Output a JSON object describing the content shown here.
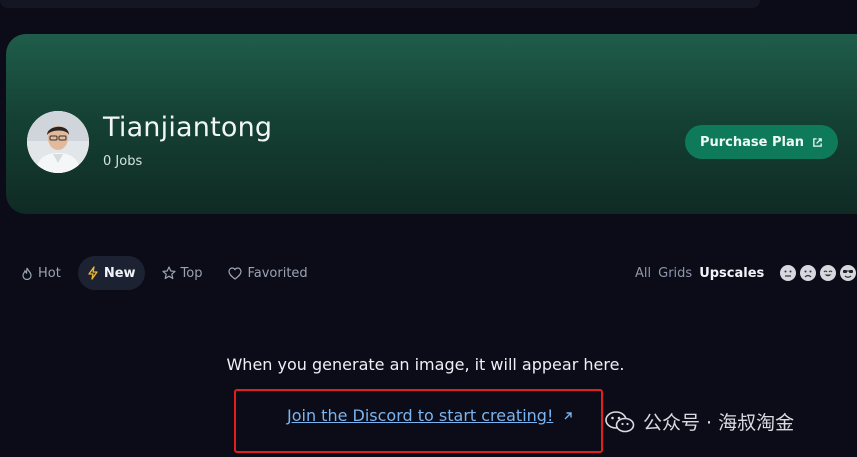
{
  "profile": {
    "username": "Tianjiantong",
    "jobs": "0 Jobs",
    "purchase_label": "Purchase Plan"
  },
  "tabs": [
    {
      "label": "Hot",
      "icon": "flame-icon"
    },
    {
      "label": "New",
      "icon": "lightning-icon",
      "active": true
    },
    {
      "label": "Top",
      "icon": "star-icon"
    },
    {
      "label": "Favorited",
      "icon": "heart-icon"
    }
  ],
  "filters": {
    "all": "All",
    "grids": "Grids",
    "upscales": "Upscales",
    "selected": "Upscales"
  },
  "emoji_filters": [
    "neutral-face-icon",
    "sad-face-icon",
    "smile-face-icon",
    "cool-face-icon"
  ],
  "empty_state": {
    "message": "When you generate an image, it will appear here.",
    "link_label": "Join the Discord to start creating!"
  },
  "watermark": {
    "text": "公众号 · 海叔淘金"
  },
  "colors": {
    "accent": "#0e7a5a",
    "link": "#7ab4f0",
    "highlight_box": "#e0201f",
    "background": "#0b0c17"
  }
}
